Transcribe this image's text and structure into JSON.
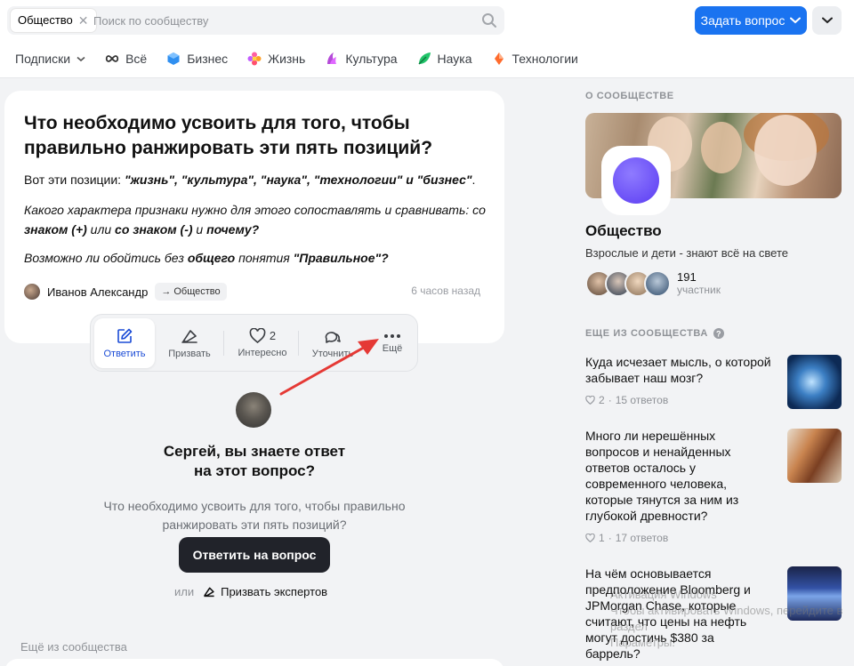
{
  "header": {
    "community_chip": "Общество",
    "chip_close": "✕",
    "search_placeholder": "Поиск по сообществу",
    "ask_button": "Задать вопрос"
  },
  "categories": [
    {
      "label": "Подписки",
      "icon": "chevron-down-icon"
    },
    {
      "label": "Всё",
      "icon": "infinity-icon"
    },
    {
      "label": "Бизнес",
      "icon": "business-cube-icon"
    },
    {
      "label": "Жизнь",
      "icon": "life-flower-icon"
    },
    {
      "label": "Культура",
      "icon": "culture-icon"
    },
    {
      "label": "Наука",
      "icon": "science-icon"
    },
    {
      "label": "Технологии",
      "icon": "technology-icon"
    }
  ],
  "question": {
    "title": "Что необходимо усвоить для того, чтобы правильно ранжировать эти пять позиций?",
    "p1_prefix": "Вот эти позиции: ",
    "p1_bold": "\"жизнь\", \"культура\", \"наука\", \"технологии\" и \"бизнес\"",
    "p1_suffix": ".",
    "p2_a": "Какого характера признаки нужно для этого сопоставлять и сравнивать: со ",
    "p2_b": "знаком (+)",
    "p2_c": " или ",
    "p2_d": "со знаком (-)",
    "p2_e": " и ",
    "p2_f": "почему?",
    "p3_a": "Возможно ли обойтись без ",
    "p3_b": "общего",
    "p3_c": " понятия ",
    "p3_d": "\"Правильное\"?",
    "author": "Иванов Александр",
    "tag": "→ Общество",
    "time": "6 часов назад"
  },
  "actions": {
    "answer": "Ответить",
    "call": "Призвать",
    "interesting": "Интересно",
    "interesting_count": "2",
    "clarify": "Уточнить",
    "more": "Ещё"
  },
  "cta": {
    "heading_line1": "Сергей, вы знаете ответ",
    "heading_line2": "на этот вопрос?",
    "sub_line1": "Что необходимо усвоить для того, чтобы правильно",
    "sub_line2": "ранжировать эти пять позиций?",
    "answer_button": "Ответить на вопрос",
    "or": "или",
    "call_experts": "Призвать экспертов",
    "more_from_community": "Ещё из сообщества"
  },
  "sidebar": {
    "about_heading": "О сообществе",
    "name": "Общество",
    "description": "Взрослые и дети - знают всё на свете",
    "member_count": "191",
    "member_label": "участник",
    "more_heading": "Еще из сообщества",
    "items": [
      {
        "title": "Куда исчезает мысль, о которой забывает наш мозг?",
        "likes": "2",
        "answers": "15 ответов"
      },
      {
        "title": "Много ли нерешённых вопросов и ненайденных ответов осталось у современного человека, которые тянутся за ним из глубокой древности?",
        "likes": "1",
        "answers": "17 ответов"
      },
      {
        "title": "На чём основывается предположение Bloomberg и JPMorgan Chase, которые считают, что цены на нефть могут достичь $380 за баррель?"
      }
    ],
    "watermark_line1": "Активация Windows",
    "watermark_line2": "Чтобы активировать Windows, перейдите в раздел",
    "watermark_line3": "Параметры."
  },
  "colors": {
    "accent": "#1a73f0",
    "dark_button": "#21232a",
    "arrow": "#e53935",
    "active_action": "#1a4bd6"
  }
}
